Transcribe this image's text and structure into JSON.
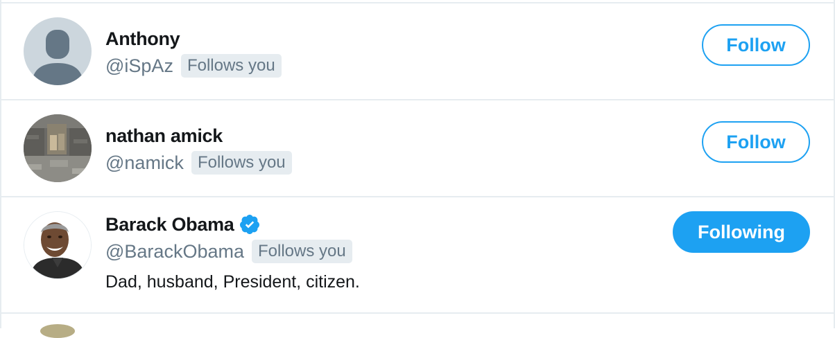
{
  "users": [
    {
      "name": "Anthony",
      "handle": "@iSpAz",
      "follows_you": "Follows you",
      "button": "Follow",
      "avatar": "default-avatar"
    },
    {
      "name": "nathan amick",
      "handle": "@namick",
      "follows_you": "Follows you",
      "button": "Follow",
      "avatar": "photo-stone-wall"
    },
    {
      "name": "Barack Obama",
      "handle": "@BarackObama",
      "follows_you": "Follows you",
      "button": "Following",
      "verified": true,
      "bio": "Dad, husband, President, citizen.",
      "avatar": "photo-portrait"
    }
  ],
  "colors": {
    "accent": "#1da1f2",
    "text_primary": "#14171a",
    "text_secondary": "#657786",
    "badge_bg": "#e6ecf0",
    "divider": "#e6ecf0"
  }
}
